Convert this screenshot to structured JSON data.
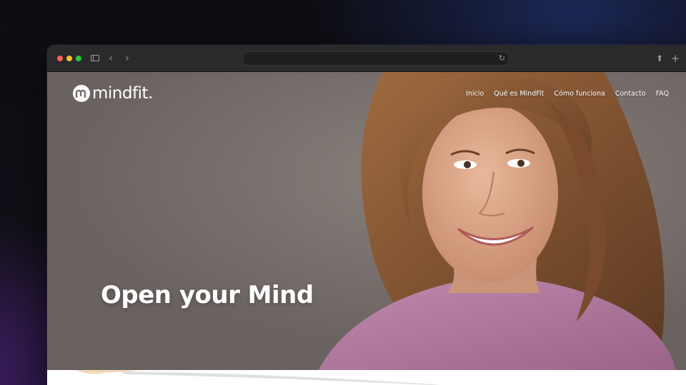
{
  "browser": {
    "address": ""
  },
  "site": {
    "logo_text": "mindfit.",
    "nav": [
      {
        "label": "Inicio"
      },
      {
        "label": "Qué es MindFit"
      },
      {
        "label": "Cómo funciona"
      },
      {
        "label": "Contacto"
      },
      {
        "label": "FAQ"
      }
    ],
    "hero_title": "Open your Mind"
  },
  "colors": {
    "hero_bg": "#766e6c",
    "sweater": "#b07a9c",
    "hair": "#8a5a38",
    "text": "#ffffff"
  }
}
